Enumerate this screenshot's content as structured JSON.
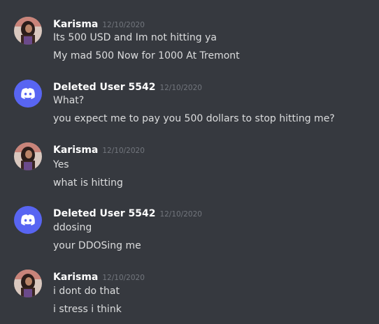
{
  "colors": {
    "background": "#36393f",
    "username": "#ffffff",
    "timestamp": "#72767d",
    "message_text": "#dcddde",
    "discord_blurple": "#5865f2"
  },
  "messages": [
    {
      "username": "Karisma",
      "timestamp": "12/10/2020",
      "avatar_icon": "user-photo-avatar",
      "lines": [
        "Its 500 USD and Im not hitting ya",
        "My mad 500 Now for 1000 At Tremont"
      ]
    },
    {
      "username": "Deleted User 5542",
      "timestamp": "12/10/2020",
      "avatar_icon": "discord-logo-avatar",
      "lines": [
        "What?",
        "you expect me to pay you 500 dollars to stop hitting me?"
      ]
    },
    {
      "username": "Karisma",
      "timestamp": "12/10/2020",
      "avatar_icon": "user-photo-avatar",
      "lines": [
        "Yes",
        "what is hitting"
      ]
    },
    {
      "username": "Deleted User 5542",
      "timestamp": "12/10/2020",
      "avatar_icon": "discord-logo-avatar",
      "lines": [
        "ddosing",
        "your DDOSing me"
      ]
    },
    {
      "username": "Karisma",
      "timestamp": "12/10/2020",
      "avatar_icon": "user-photo-avatar",
      "lines": [
        "i dont do that",
        "i stress i think"
      ]
    }
  ]
}
